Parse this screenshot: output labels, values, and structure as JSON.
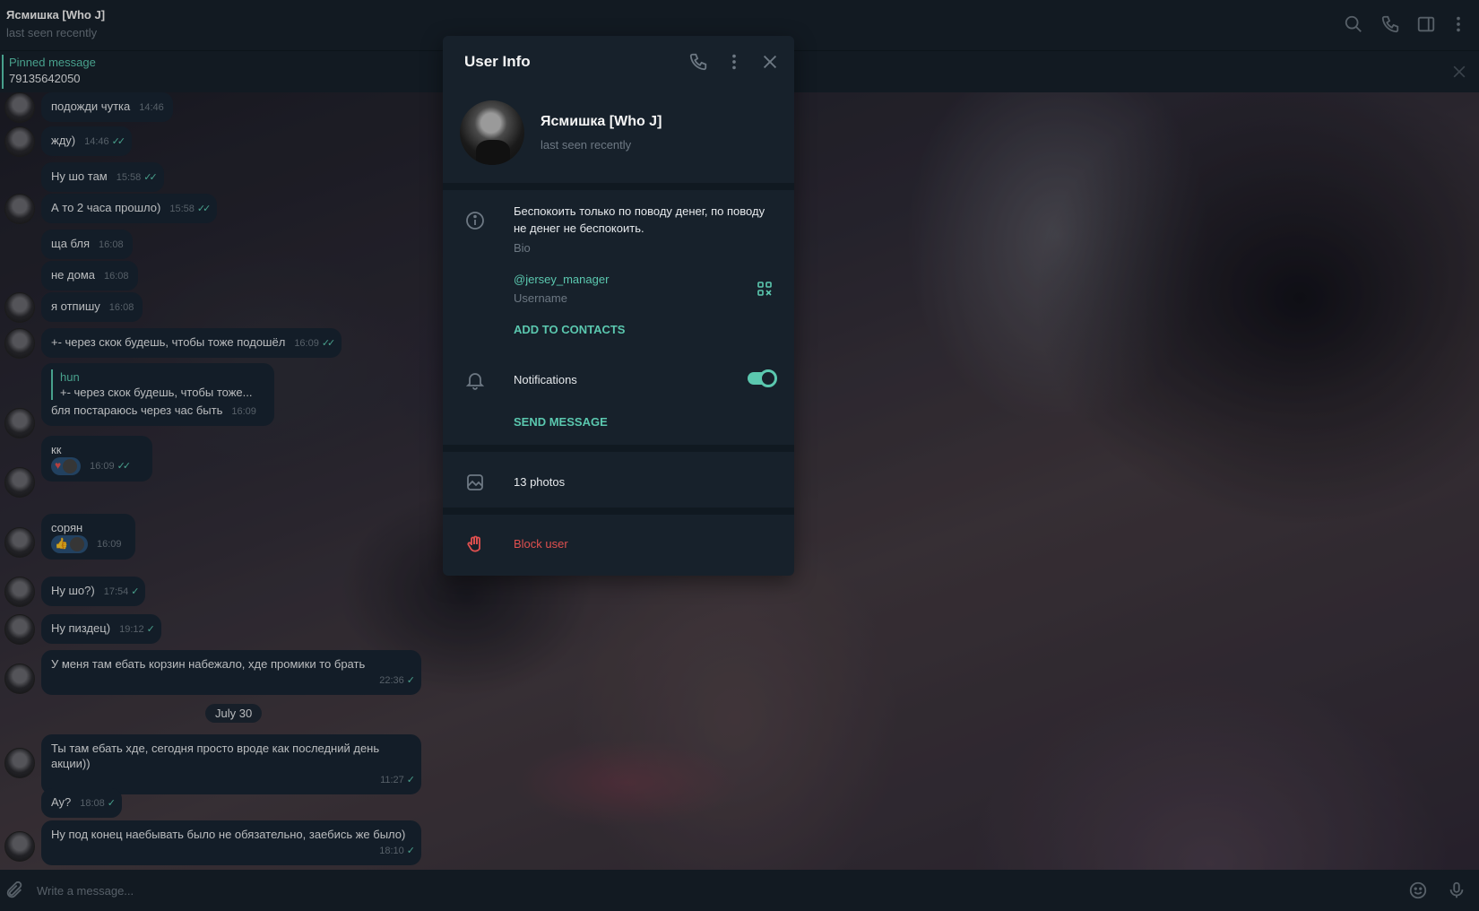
{
  "header": {
    "title": "Ясмишка [Who J]",
    "status": "last seen recently"
  },
  "pinned": {
    "label": "Pinned message",
    "text": "79135642050"
  },
  "messages": [
    {
      "text": "подожди чутка",
      "time": "14:46",
      "checks": ""
    },
    {
      "text": "жду)",
      "time": "14:46",
      "checks": "✓✓"
    },
    {
      "text": "Ну шо там",
      "time": "15:58",
      "checks": "✓✓"
    },
    {
      "text": "А то 2 часа прошло)",
      "time": "15:58",
      "checks": "✓✓"
    },
    {
      "text": "ща бля",
      "time": "16:08",
      "checks": ""
    },
    {
      "text": "не дома",
      "time": "16:08",
      "checks": ""
    },
    {
      "text": "я отпишу",
      "time": "16:08",
      "checks": ""
    },
    {
      "text": "+- через скок будешь, чтобы тоже подошёл",
      "time": "16:09",
      "checks": "✓✓"
    },
    {
      "reply_name": "hun",
      "reply_text": "+- через скок будешь, чтобы тоже...",
      "text": "бля постараюсь через час быть",
      "time": "16:09",
      "checks": ""
    },
    {
      "text": "кк",
      "reaction": "♥",
      "time": "16:09",
      "checks": "✓✓"
    },
    {
      "text": "сорян",
      "reaction": "👍",
      "time": "16:09",
      "checks": ""
    },
    {
      "text": "Ну шо?)",
      "time": "17:54",
      "checks": "✓"
    },
    {
      "text": "Ну пиздец)",
      "time": "19:12",
      "checks": "✓"
    },
    {
      "text": "У меня там ебать корзин набежало, хде промики то брать",
      "time": "22:36",
      "checks": "✓"
    },
    {
      "text": "Ты там ебать хде, сегодня просто вроде как последний день акции))",
      "time": "11:27",
      "checks": "✓"
    },
    {
      "text": "Ау?",
      "time": "18:08",
      "checks": "✓"
    },
    {
      "text": "Ну под конец наебывать было не обязательно, заебись же было)",
      "time": "18:10",
      "checks": "✓"
    }
  ],
  "date_separator": "July 30",
  "composer": {
    "placeholder": "Write a message..."
  },
  "modal": {
    "title": "User Info",
    "name": "Ясмишка [Who J]",
    "status": "last seen recently",
    "bio": "Беспокоить только по поводу денег, по поводу не денег не беспокоить.",
    "bio_label": "Bio",
    "username": "@jersey_manager",
    "username_label": "Username",
    "add_contact": "ADD TO CONTACTS",
    "notifications": "Notifications",
    "notifications_on": true,
    "send_message": "SEND MESSAGE",
    "photos": "13 photos",
    "block": "Block user"
  },
  "colors": {
    "accent": "#5bc8af",
    "danger": "#e0504f",
    "panel": "#17212b",
    "bubble": "#182533"
  }
}
